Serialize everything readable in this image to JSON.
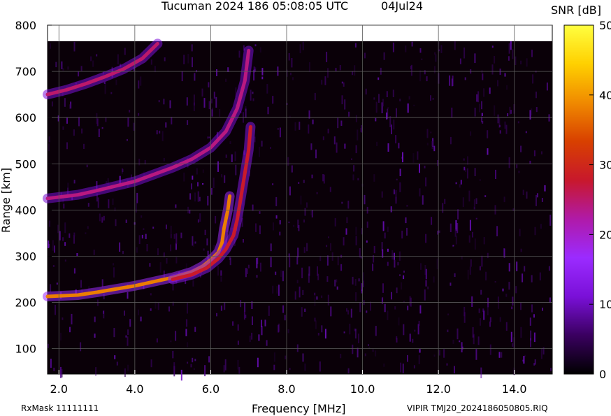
{
  "chart_data": {
    "type": "heatmap",
    "title": "Tucuman 2024 186 05:08:05 UTC",
    "date_label": "04Jul24",
    "xlabel": "Frequency [MHz]",
    "ylabel": "Range [km]",
    "xlim": [
      1.7,
      15.0
    ],
    "ylim": [
      45,
      800
    ],
    "x_ticks": [
      2.0,
      4.0,
      6.0,
      8.0,
      10.0,
      12.0,
      14.0
    ],
    "x_tick_labels": [
      "2.0",
      "4.0",
      "6.0",
      "8.0",
      "10.0",
      "12.0",
      "14.0"
    ],
    "y_ticks": [
      100,
      200,
      300,
      400,
      500,
      600,
      700,
      800
    ],
    "y_tick_labels": [
      "100",
      "200",
      "300",
      "400",
      "500",
      "600",
      "700",
      "800"
    ],
    "grid": true,
    "colorbar": {
      "label": "SNR [dB]",
      "range": [
        0,
        50
      ],
      "ticks": [
        0,
        10,
        20,
        30,
        40,
        50
      ],
      "tick_labels": [
        "0",
        "10",
        "20",
        "30",
        "40",
        "50"
      ],
      "colors": [
        "#000000",
        "#3a0060",
        "#7a10d8",
        "#9b2bff",
        "#b01aa8",
        "#c8182c",
        "#d84000",
        "#f08a00",
        "#ffd000",
        "#ffff40"
      ]
    },
    "traces": [
      {
        "name_hint": "E-layer echo",
        "points": [
          [
            1.7,
            213
          ],
          [
            2.5,
            216
          ],
          [
            3.0,
            222
          ],
          [
            3.5,
            229
          ],
          [
            4.0,
            236
          ],
          [
            4.5,
            245
          ],
          [
            5.0,
            254
          ],
          [
            5.5,
            266
          ],
          [
            5.8,
            279
          ],
          [
            6.0,
            292
          ],
          [
            6.2,
            308
          ],
          [
            6.3,
            330
          ],
          [
            6.35,
            360
          ],
          [
            6.45,
            400
          ],
          [
            6.5,
            430
          ]
        ],
        "snr": 38
      },
      {
        "name_hint": "E-layer x-trace",
        "points": [
          [
            5.0,
            250
          ],
          [
            5.5,
            260
          ],
          [
            5.9,
            275
          ],
          [
            6.2,
            295
          ],
          [
            6.4,
            315
          ],
          [
            6.6,
            345
          ],
          [
            6.7,
            380
          ],
          [
            6.8,
            430
          ],
          [
            6.9,
            480
          ],
          [
            7.0,
            530
          ],
          [
            7.05,
            580
          ]
        ],
        "snr": 28
      },
      {
        "name_hint": "F-layer lower",
        "points": [
          [
            1.7,
            425
          ],
          [
            2.5,
            433
          ],
          [
            3.0,
            442
          ],
          [
            3.5,
            452
          ],
          [
            4.0,
            462
          ],
          [
            4.5,
            477
          ],
          [
            5.0,
            492
          ],
          [
            5.5,
            510
          ],
          [
            6.0,
            535
          ],
          [
            6.4,
            570
          ],
          [
            6.7,
            620
          ],
          [
            6.9,
            680
          ],
          [
            7.0,
            745
          ]
        ],
        "snr": 24
      },
      {
        "name_hint": "F-layer upper",
        "points": [
          [
            1.7,
            650
          ],
          [
            2.2,
            660
          ],
          [
            2.7,
            673
          ],
          [
            3.2,
            688
          ],
          [
            3.7,
            705
          ],
          [
            4.2,
            728
          ],
          [
            4.6,
            760
          ]
        ],
        "snr": 25
      }
    ]
  },
  "footer": {
    "rxmask": "RxMask 11111111",
    "file": "VIPIR  TMJ20_2024186050805.RIQ"
  }
}
